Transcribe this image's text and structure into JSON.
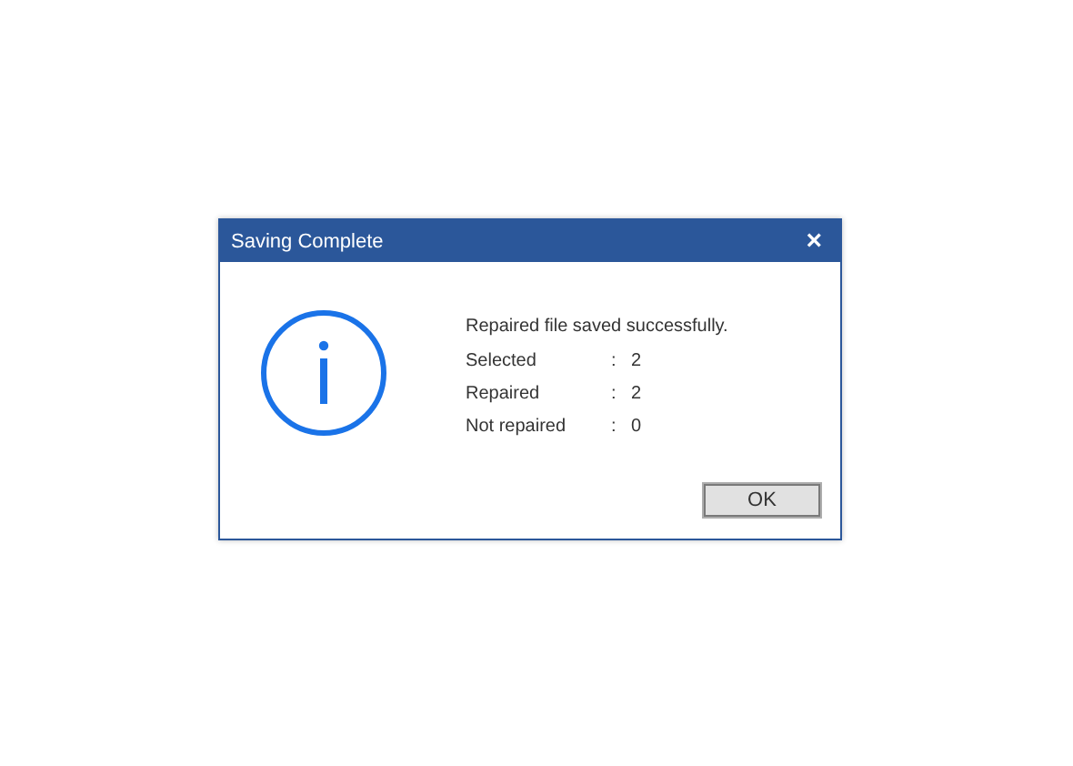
{
  "window": {
    "title": "Saving Complete",
    "close": "×"
  },
  "message": "Repaired file saved successfully.",
  "stats": [
    {
      "label": "Selected",
      "separator": ":",
      "value": "2"
    },
    {
      "label": "Repaired",
      "separator": ":",
      "value": "2"
    },
    {
      "label": "Not repaired",
      "separator": ":",
      "value": "0"
    }
  ],
  "buttons": [
    "OK"
  ]
}
